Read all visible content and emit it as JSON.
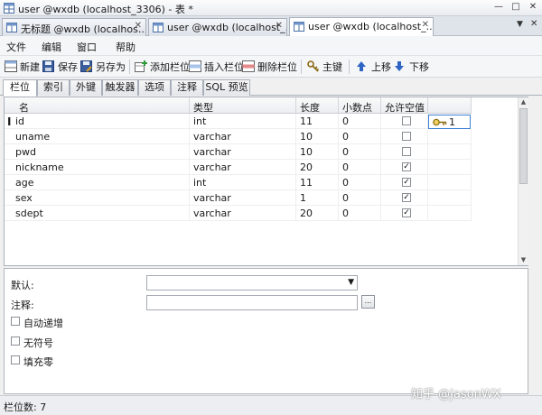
{
  "window": {
    "title": "user @wxdb (localhost_3306) - 表 *",
    "minimize": "—",
    "maximize": "□",
    "close": "✕"
  },
  "doc_tabs": [
    {
      "label": "无标题 @wxdb (localhos..."
    },
    {
      "label": "user @wxdb (localhost_..."
    },
    {
      "label": "user @wxdb (localhost_..."
    }
  ],
  "doc_tabs_controls": {
    "dropdown": "▼",
    "close": "✕",
    "tab_close": "✕"
  },
  "menu": [
    "文件",
    "编辑",
    "窗口",
    "帮助"
  ],
  "toolbar": {
    "new": "新建",
    "save": "保存",
    "save_as": "另存为",
    "add_column": "添加栏位",
    "insert_column": "插入栏位",
    "delete_column": "删除栏位",
    "primary_key": "主键",
    "move_up": "上移",
    "move_down": "下移"
  },
  "sub_tabs": [
    "栏位",
    "索引",
    "外键",
    "触发器",
    "选项",
    "注释",
    "SQL 预览"
  ],
  "grid": {
    "headers": [
      "名",
      "类型",
      "长度",
      "小数点",
      "允许空值 ("
    ],
    "rows": [
      {
        "name": "id",
        "type": "int",
        "length": "11",
        "decimals": "0",
        "nullable": false
      },
      {
        "name": "uname",
        "type": "varchar",
        "length": "10",
        "decimals": "0",
        "nullable": false
      },
      {
        "name": "pwd",
        "type": "varchar",
        "length": "10",
        "decimals": "0",
        "nullable": false
      },
      {
        "name": "nickname",
        "type": "varchar",
        "length": "20",
        "decimals": "0",
        "nullable": true
      },
      {
        "name": "age",
        "type": "int",
        "length": "11",
        "decimals": "0",
        "nullable": true
      },
      {
        "name": "sex",
        "type": "varchar",
        "length": "1",
        "decimals": "0",
        "nullable": true
      },
      {
        "name": "sdept",
        "type": "varchar",
        "length": "20",
        "decimals": "0",
        "nullable": true
      }
    ],
    "row_indicator": "I",
    "key_value": "1",
    "check_mark": "✓"
  },
  "properties": {
    "default_label": "默认:",
    "comment_label": "注释:",
    "comment_button": "...",
    "auto_increment": "自动递增",
    "unsigned": "无符号",
    "zerofill": "填充零"
  },
  "status": {
    "field_count": "栏位数: 7"
  },
  "watermark": "知乎 @JasonWX"
}
